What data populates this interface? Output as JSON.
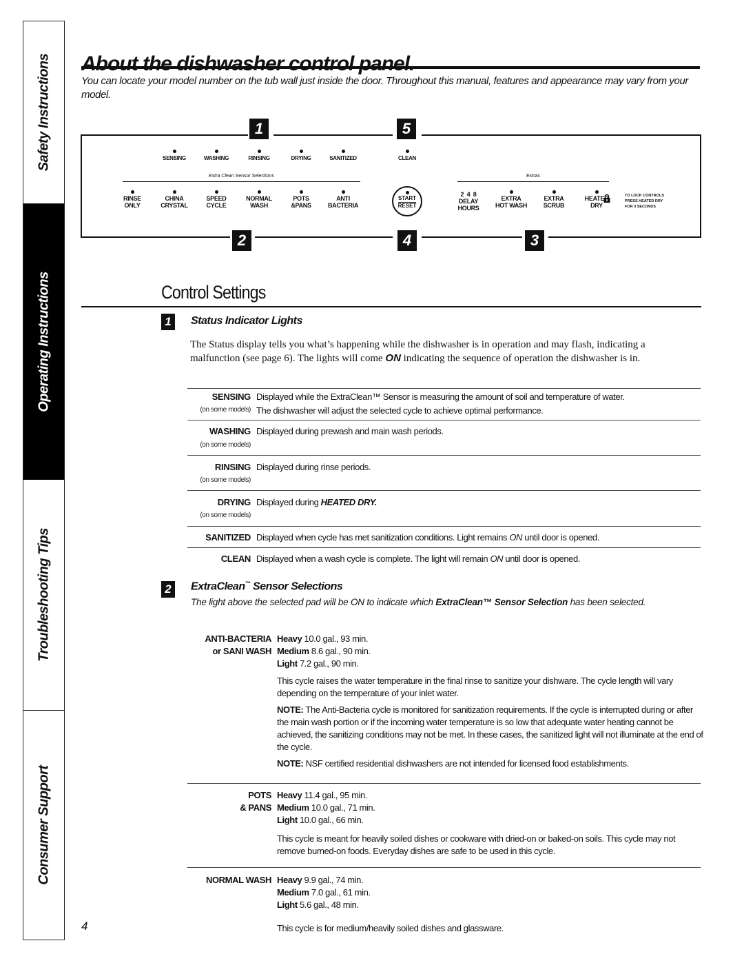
{
  "side_tabs": [
    {
      "label": "Safety Instructions",
      "active": false
    },
    {
      "label": "Operating Instructions",
      "active": true
    },
    {
      "label": "Troubleshooting Tips",
      "active": false
    },
    {
      "label": "Consumer Support",
      "active": false
    }
  ],
  "header": {
    "title": "About the dishwasher control panel.",
    "intro": "You can locate your model number on the tub wall just inside the door. Throughout this manual, features and appearance may vary from your model."
  },
  "panel": {
    "callouts": [
      "1",
      "5",
      "2",
      "4",
      "3"
    ],
    "status_lights": [
      "SENSING",
      "WASHING",
      "RINSING",
      "DRYING",
      "SANITIZED",
      "CLEAN"
    ],
    "sensor_label_italic": "Extra Clean",
    "sensor_label_rest": " Sensor Selections",
    "cycles": [
      {
        "l1": "RINSE",
        "l2": "ONLY"
      },
      {
        "l1": "CHINA",
        "l2": "CRYSTAL"
      },
      {
        "l1": "SPEED",
        "l2": "CYCLE"
      },
      {
        "l1": "NORMAL",
        "l2": "WASH"
      },
      {
        "l1": "POTS",
        "l2": "&PANS"
      },
      {
        "l1": "ANTI",
        "l2": "BACTERIA"
      }
    ],
    "start": {
      "l1": "START",
      "l2": "RESET"
    },
    "extras_label": "Extras",
    "delay": {
      "hours": "2  4  8",
      "l1": "DELAY",
      "l2": "HOURS"
    },
    "extras": [
      {
        "l1": "EXTRA",
        "l2": "HOT WASH"
      },
      {
        "l1": "EXTRA",
        "l2": "SCRUB"
      },
      {
        "l1": "HEATED",
        "l2": "DRY"
      }
    ],
    "lock_text": [
      "TO LOCK CONTROLS",
      "PRESS HEATED DRY",
      "FOR 3 SECONDS"
    ]
  },
  "control_settings": {
    "title": "Control Settings",
    "section1": {
      "num": "1",
      "heading": "Status Indicator Lights",
      "body_a": "The Status display tells you what’s happening while the dishwasher is in operation and may flash, indicating a malfunction (see page 6). The lights will come ",
      "body_on": "ON",
      "body_b": " indicating the sequence of operation the dishwasher is in.",
      "rows": [
        {
          "term": "SENSING",
          "note": "(on some models)",
          "line1": "Displayed while the ExtraClean™ Sensor is measuring the amount of soil and temperature of water.",
          "line2": "The dishwasher will adjust the selected cycle to achieve optimal performance."
        },
        {
          "term": "WASHING",
          "note": "(on some models)",
          "line1": "Displayed during prewash and main wash periods."
        },
        {
          "term": "RINSING",
          "note": "(on some models)",
          "line1": "Displayed during rinse periods."
        },
        {
          "term": "DRYING",
          "note": "(on some models)",
          "line1_pre": "Displayed during ",
          "line1_em": "HEATED DRY."
        },
        {
          "term": "SANITIZED",
          "line1_pre": "Displayed when cycle has met sanitization conditions. Light remains ",
          "line1_em": "ON",
          "line1_post": " until door is opened."
        },
        {
          "term": "CLEAN",
          "line1_pre": "Displayed when a wash cycle is complete. The light will remain ",
          "line1_em": "ON",
          "line1_post": " until door is opened."
        }
      ]
    },
    "section2": {
      "num": "2",
      "heading_a": "ExtraClean",
      "heading_tm": "™",
      "heading_b": " Sensor Selections",
      "sub_a": "The light above the selected pad will be ON to indicate which ",
      "sub_bold": "ExtraClean™ Sensor Selection",
      "sub_b": " has been selected.",
      "cycles": [
        {
          "term_l1": "ANTI-BACTERIA",
          "term_l2": "or SANI WASH",
          "levels": [
            {
              "level": "Heavy",
              "spec": " 10.0 gal., 93 min."
            },
            {
              "level": "Medium",
              "spec": " 8.6 gal., 90 min."
            },
            {
              "level": "Light",
              "spec": " 7.2 gal., 90 min."
            }
          ],
          "desc": "This cycle raises the water temperature in the final rinse to sanitize your dishware. The cycle length will vary depending on the temperature of your inlet water.",
          "note1_label": "NOTE:",
          "note1": " The Anti-Bacteria cycle is monitored for sanitization requirements. If the cycle is interrupted during or after the main wash portion or if the incoming water temperature is so low that adequate water heating cannot be achieved, the sanitizing conditions may not be met. In these cases, the sanitized light will not illuminate at the end of the cycle.",
          "note2_label": "NOTE:",
          "note2": " NSF certified residential dishwashers are not intended for licensed food establishments."
        },
        {
          "term_l1": "POTS",
          "term_l2": "& PANS",
          "levels": [
            {
              "level": "Heavy",
              "spec": " 11.4 gal., 95 min."
            },
            {
              "level": "Medium",
              "spec": " 10.0 gal., 71 min."
            },
            {
              "level": "Light",
              "spec": " 10.0 gal., 66 min."
            }
          ],
          "desc": "This cycle is meant for heavily soiled dishes or cookware with dried-on or baked-on soils. This cycle may not remove burned-on foods. Everyday dishes are safe to be used in this cycle."
        },
        {
          "term_l1": "NORMAL WASH",
          "levels": [
            {
              "level": "Heavy",
              "spec": " 9.9 gal., 74 min."
            },
            {
              "level": "Medium",
              "spec": " 7.0 gal., 61 min."
            },
            {
              "level": "Light",
              "spec": " 5.6 gal., 48 min."
            }
          ],
          "desc": "This cycle is for medium/heavily soiled dishes and glassware."
        }
      ]
    }
  },
  "page_number": "4"
}
